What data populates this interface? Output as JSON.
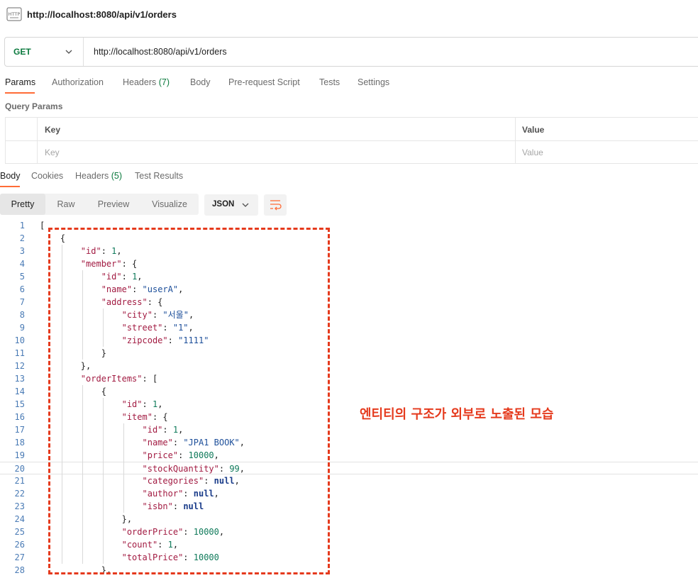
{
  "window": {
    "title": "http://localhost:8080/api/v1/orders"
  },
  "request": {
    "method": "GET",
    "url": "http://localhost:8080/api/v1/orders"
  },
  "request_tabs": [
    {
      "label": "Params",
      "active": true
    },
    {
      "label": "Authorization"
    },
    {
      "label": "Headers",
      "count": "(7)"
    },
    {
      "label": "Body"
    },
    {
      "label": "Pre-request Script"
    },
    {
      "label": "Tests"
    },
    {
      "label": "Settings"
    }
  ],
  "query_params": {
    "title": "Query Params",
    "headers": {
      "key": "Key",
      "value": "Value"
    },
    "placeholders": {
      "key": "Key",
      "value": "Value"
    }
  },
  "response_tabs": [
    {
      "label": "Body",
      "active": true
    },
    {
      "label": "Cookies"
    },
    {
      "label": "Headers",
      "count": "(5)"
    },
    {
      "label": "Test Results"
    }
  ],
  "format": {
    "modes": [
      "Pretty",
      "Raw",
      "Preview",
      "Visualize"
    ],
    "active": "Pretty",
    "language": "JSON"
  },
  "code_lines": [
    "[",
    "    {",
    "        \"id\": 1,",
    "        \"member\": {",
    "            \"id\": 1,",
    "            \"name\": \"userA\",",
    "            \"address\": {",
    "                \"city\": \"서울\",",
    "                \"street\": \"1\",",
    "                \"zipcode\": \"1111\"",
    "            }",
    "        },",
    "        \"orderItems\": [",
    "            {",
    "                \"id\": 1,",
    "                \"item\": {",
    "                    \"id\": 1,",
    "                    \"name\": \"JPA1 BOOK\",",
    "                    \"price\": 10000,",
    "                    \"stockQuantity\": 99,",
    "                    \"categories\": null,",
    "                    \"author\": null,",
    "                    \"isbn\": null",
    "                },",
    "                \"orderPrice\": 10000,",
    "                \"count\": 1,",
    "                \"totalPrice\": 10000",
    "            },"
  ],
  "annotation": "엔티티의 구조가 외부로 노출된 모습",
  "colors": {
    "accent": "#ff6c37",
    "annotation": "#e53a1d",
    "method_get": "#0b7a3e"
  },
  "icons": [
    "http-icon",
    "chevron-down-icon",
    "wrap-lines-icon"
  ]
}
